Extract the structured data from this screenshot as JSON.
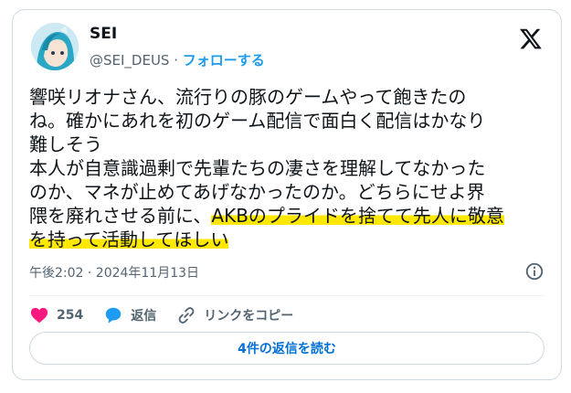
{
  "author": {
    "name": "SEI",
    "handle": "@SEI_DEUS",
    "separator": " · ",
    "follow_label": "フォローする"
  },
  "tweet": {
    "lines": [
      "響咲リオナさん、流行りの豚のゲームやって飽きたの",
      "ね。確かにあれを初のゲーム配信で面白く配信はかなり",
      "難しそう",
      "本人が自意識過剰で先輩たちの凄さを理解してなかった",
      "のか、マネが止めてあげなかったのか。どちらにせよ界",
      "隈を廃れさせる前に、",
      "AKBのプライドを捨てて先人に敬意",
      "を持って活動してほしい"
    ],
    "timestamp": "午後2:02 · 2024年11月13日"
  },
  "actions": {
    "like_count": "254",
    "reply_label": "返信",
    "copy_link_label": "リンクをコピー"
  },
  "replies_button": "4件の返信を読む",
  "colors": {
    "accent": "#1d9bf0",
    "like": "#f91880",
    "highlight": "#ffe800",
    "muted": "#536471"
  }
}
